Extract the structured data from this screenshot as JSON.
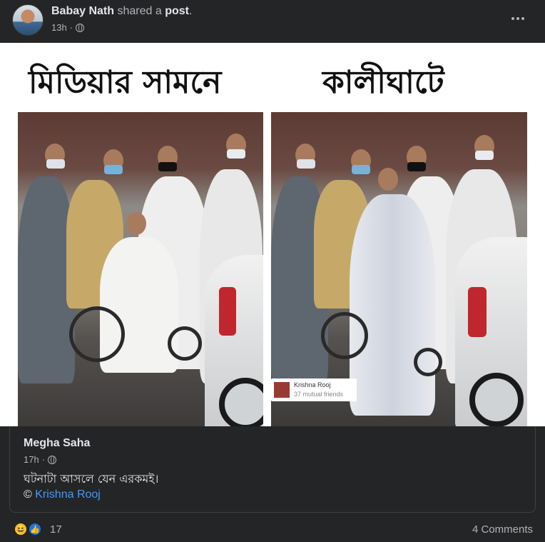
{
  "header": {
    "author": "Babay Nath",
    "action_text": "shared a",
    "object_text": "post",
    "period": ".",
    "time": "13h",
    "separator": "·"
  },
  "image": {
    "left_title": "মিডিয়ার সামনে",
    "right_title": "কালীঘাটে",
    "tag": {
      "name": "Krishna Rooj",
      "subtitle": "37 mutual friends"
    }
  },
  "shared_post": {
    "author": "Megha Saha",
    "time": "17h",
    "separator": "·",
    "text": "ঘটনাটা আসলে যেন এরকমই।",
    "credit_symbol": "©",
    "credit_name": "Krishna Rooj"
  },
  "footer": {
    "reaction_count": "17",
    "comments": "4 Comments"
  },
  "colors": {
    "background": "#242526",
    "link": "#4599ff",
    "like_blue": "#1b74e4",
    "haha_yellow": "#f7c733"
  }
}
